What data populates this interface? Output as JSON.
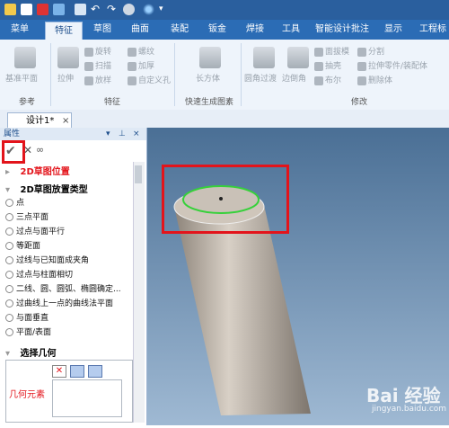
{
  "title_bar": {
    "quick_access_icons": [
      "folder-icon",
      "new-icon",
      "close-doc-icon",
      "save-icon",
      "undo-icon",
      "redo-icon",
      "shape-icon",
      "pattern-icon",
      "dropdown-icon"
    ]
  },
  "tabs": [
    "菜单",
    "特征",
    "草图",
    "曲面",
    "装配",
    "钣金",
    "焊接",
    "工具",
    "智能设计批注",
    "显示",
    "工程标"
  ],
  "active_tab": "特征",
  "ribbon": {
    "ref_group": {
      "label": "参考",
      "button": "基准平面"
    },
    "feature_group": {
      "label": "特征",
      "button": "拉伸",
      "items": [
        "旋转",
        "扫描",
        "放样",
        "螺纹",
        "加厚",
        "自定义孔"
      ]
    },
    "fast_group": {
      "label": "快速生成图素",
      "button": "长方体"
    },
    "modify_group": {
      "label": "修改",
      "buttons": [
        "圆角过渡",
        "边倒角"
      ],
      "items": [
        "面拔模",
        "抽壳",
        "布尔",
        "分割",
        "拉伸零件/装配体",
        "删除体"
      ]
    }
  },
  "doc_tab": {
    "label": "设计1*",
    "close": "×"
  },
  "panel": {
    "title": "属性",
    "header_icons": [
      "chevron-down-icon",
      "pin-icon",
      "close-icon"
    ],
    "ok": "✔",
    "cancel": "✕",
    "section1": "2D草图位置",
    "section2": "2D草图放置类型",
    "options": [
      "点",
      "三点平面",
      "过点与面平行",
      "等距面",
      "过线与已知面成夹角",
      "过点与柱面相切",
      "二线、圆、圆弧、椭圆确定...",
      "过曲线上一点的曲线法平面",
      "与面垂直",
      "平面/表面"
    ],
    "section3": "选择几何",
    "geom_label": "几何元素"
  },
  "watermark": "Bai 经验",
  "watermark_url": "jingyan.baidu.com"
}
